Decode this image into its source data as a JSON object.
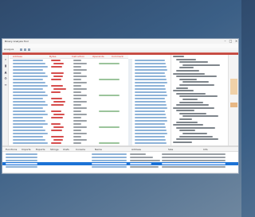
{
  "window": {
    "title": "Binary Analysis Tool",
    "menus": [
      "File",
      "Edit",
      "View",
      "Go",
      "Help"
    ],
    "toolbar_label": "Analysis"
  },
  "columns": [
    "Address",
    "Bytes",
    "Instruction",
    "Operands",
    "Comment"
  ],
  "bottom_panel": {
    "tabs": [
      "Functions",
      "Imports",
      "Exports",
      "Strings",
      "Xrefs",
      "Console"
    ],
    "columns": [
      "Name",
      "Address",
      "Size",
      "Info"
    ],
    "rows": [
      "function_1",
      "function_2",
      "function_3",
      "function_4",
      "function_5"
    ],
    "selected_row": 3
  },
  "colors": {
    "accent_bar": "#c64d44",
    "selection": "#1c73d6",
    "mnemonic": "#d64e4e",
    "address": "#8eb3d8",
    "comment": "#9bc49b"
  },
  "icons": [
    "search-icon",
    "bookmark-icon",
    "graph-icon",
    "settings-icon",
    "list-icon"
  ]
}
